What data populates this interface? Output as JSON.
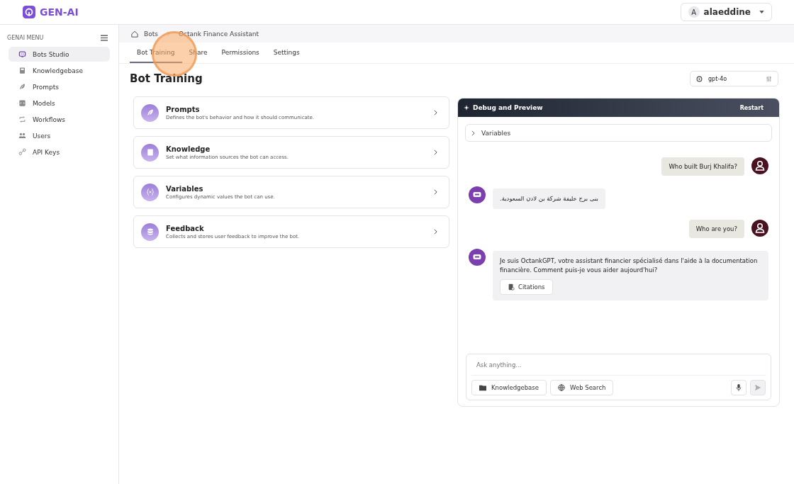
{
  "header": {
    "logo": "GEN-AI",
    "user": {
      "initial": "A",
      "name": "alaeddine"
    }
  },
  "sidebar": {
    "heading": "GENAI MENU",
    "items": [
      {
        "label": "Bots Studio",
        "selected": true
      },
      {
        "label": "Knowledgebase",
        "selected": false
      },
      {
        "label": "Prompts",
        "selected": false
      },
      {
        "label": "Models",
        "selected": false
      },
      {
        "label": "Workflows",
        "selected": false
      },
      {
        "label": "Users",
        "selected": false
      },
      {
        "label": "API Keys",
        "selected": false
      }
    ]
  },
  "breadcrumb": [
    "Bots",
    "Octank Finance Assistant"
  ],
  "tabs": [
    {
      "label": "Bot Training",
      "selected": true
    },
    {
      "label": "Share",
      "selected": false
    },
    {
      "label": "Permissions",
      "selected": false
    },
    {
      "label": "Settings",
      "selected": false
    }
  ],
  "page_title": "Bot Training",
  "model_selector": {
    "value": "gpt-4o"
  },
  "cards": [
    {
      "title": "Prompts",
      "description": "Defines the bot's behavior and how it should communicate."
    },
    {
      "title": "Knowledge",
      "description": "Set what information sources the bot can access."
    },
    {
      "title": "Variables",
      "description": "Configures dynamic values the bot can use."
    },
    {
      "title": "Feedback",
      "description": "Collects and stores user feedback to improve the bot."
    }
  ],
  "preview": {
    "title": "Debug and Preview",
    "restart": "Restart",
    "variables": {
      "label": "Variables",
      "expanded": false
    },
    "messages": [
      {
        "kind": "user",
        "text": "Who built Burj Khalifa?"
      },
      {
        "kind": "bot",
        "text": "بنى برج خليفة شركة بن لادن السعودية."
      },
      {
        "kind": "user",
        "text": "Who are you?"
      },
      {
        "kind": "bot",
        "text": "Je suis OctankGPT, votre assistant financier spécialisé dans l'aide à la documentation financière. Comment puis-je vous aider aujourd'hui?",
        "citations": "Citations"
      }
    ],
    "input": {
      "placeholder": "Ask anything..."
    },
    "tools": [
      "Knowledgebase",
      "Web Search"
    ]
  }
}
